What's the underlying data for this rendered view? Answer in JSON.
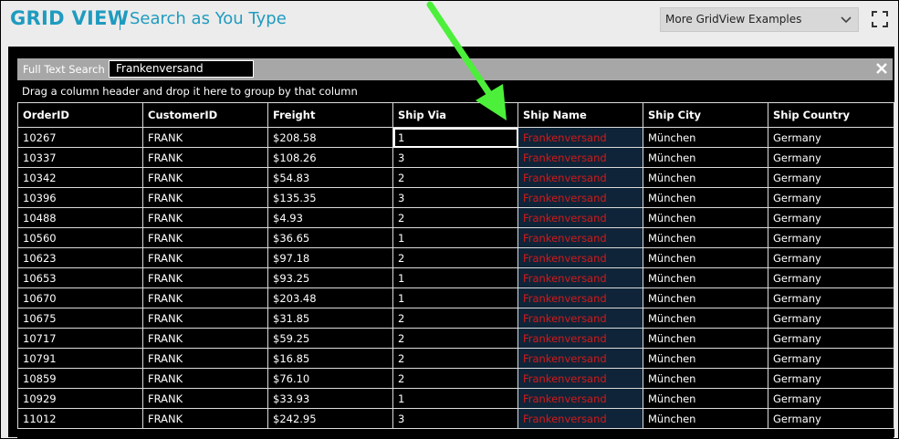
{
  "header": {
    "app_title": "GRID VIEW",
    "subtitle": "Search as You Type",
    "examples_dropdown": "More GridView Examples"
  },
  "search": {
    "label": "Full Text Search",
    "value": "Frankenversand"
  },
  "group_panel": {
    "hint": "Drag a column header and drop it here to group by that column"
  },
  "grid": {
    "columns": [
      "OrderID",
      "CustomerID",
      "Freight",
      "Ship Via",
      "Ship Name",
      "Ship City",
      "Ship Country"
    ],
    "rows": [
      [
        "10267",
        "FRANK",
        "$208.58",
        "1",
        "Frankenversand",
        "München",
        "Germany"
      ],
      [
        "10337",
        "FRANK",
        "$108.26",
        "3",
        "Frankenversand",
        "München",
        "Germany"
      ],
      [
        "10342",
        "FRANK",
        "$54.83",
        "2",
        "Frankenversand",
        "München",
        "Germany"
      ],
      [
        "10396",
        "FRANK",
        "$135.35",
        "3",
        "Frankenversand",
        "München",
        "Germany"
      ],
      [
        "10488",
        "FRANK",
        "$4.93",
        "2",
        "Frankenversand",
        "München",
        "Germany"
      ],
      [
        "10560",
        "FRANK",
        "$36.65",
        "1",
        "Frankenversand",
        "München",
        "Germany"
      ],
      [
        "10623",
        "FRANK",
        "$97.18",
        "2",
        "Frankenversand",
        "München",
        "Germany"
      ],
      [
        "10653",
        "FRANK",
        "$93.25",
        "1",
        "Frankenversand",
        "München",
        "Germany"
      ],
      [
        "10670",
        "FRANK",
        "$203.48",
        "1",
        "Frankenversand",
        "München",
        "Germany"
      ],
      [
        "10675",
        "FRANK",
        "$31.85",
        "2",
        "Frankenversand",
        "München",
        "Germany"
      ],
      [
        "10717",
        "FRANK",
        "$59.25",
        "2",
        "Frankenversand",
        "München",
        "Germany"
      ],
      [
        "10791",
        "FRANK",
        "$16.85",
        "2",
        "Frankenversand",
        "München",
        "Germany"
      ],
      [
        "10859",
        "FRANK",
        "$76.10",
        "2",
        "Frankenversand",
        "München",
        "Germany"
      ],
      [
        "10929",
        "FRANK",
        "$33.93",
        "1",
        "Frankenversand",
        "München",
        "Germany"
      ],
      [
        "11012",
        "FRANK",
        "$242.95",
        "3",
        "Frankenversand",
        "München",
        "Germany"
      ]
    ]
  },
  "colors": {
    "accent": "#1f9bbf",
    "highlight_text": "#d21a1a",
    "highlight_bg": "#0f2438",
    "arrow": "#4cf03a"
  },
  "icons": {
    "dropdown": "chevron-down-icon",
    "fullscreen": "fullscreen-icon",
    "close": "close-icon",
    "annotation": "arrow-icon"
  }
}
